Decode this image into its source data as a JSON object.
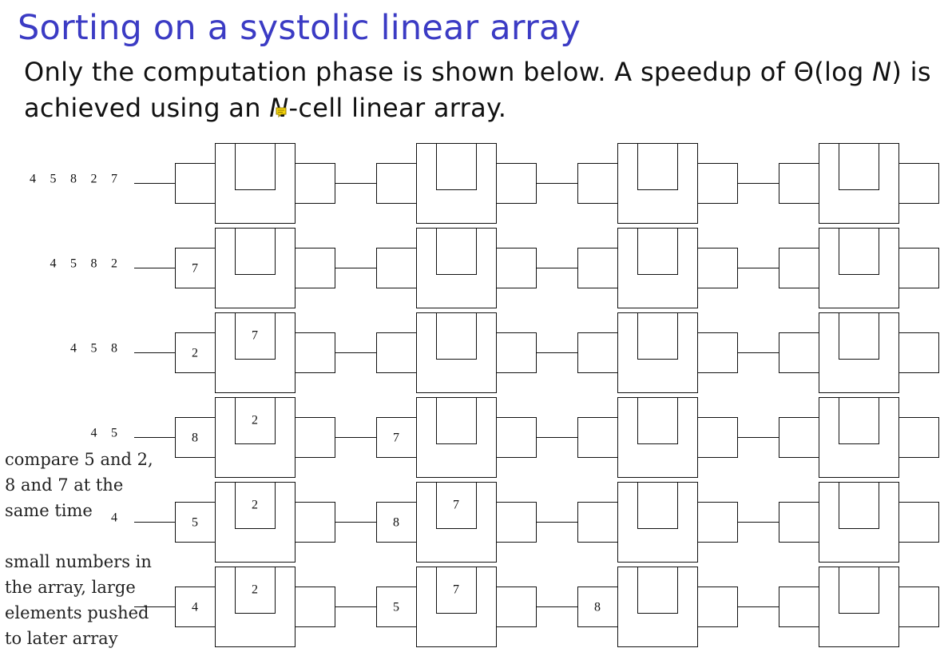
{
  "slide": {
    "title": "Sorting on a systolic linear array",
    "body": {
      "part1": "Only the computation phase is shown below. A speedup of Θ(log ",
      "var1": "N",
      "part2": ") is achieved using an ",
      "var2": "N",
      "part3": "-cell linear array."
    }
  },
  "diagram": {
    "rows": [
      {
        "input": [
          "4",
          "5",
          "8",
          "2",
          "7"
        ],
        "cells": [
          {
            "left": "",
            "top": ""
          },
          {
            "left": "",
            "top": ""
          },
          {
            "left": "",
            "top": ""
          },
          {
            "left": "",
            "top": ""
          }
        ]
      },
      {
        "input": [
          "4",
          "5",
          "8",
          "2"
        ],
        "cells": [
          {
            "left": "7",
            "top": ""
          },
          {
            "left": "",
            "top": ""
          },
          {
            "left": "",
            "top": ""
          },
          {
            "left": "",
            "top": ""
          }
        ]
      },
      {
        "input": [
          "4",
          "5",
          "8"
        ],
        "cells": [
          {
            "left": "2",
            "top": "7"
          },
          {
            "left": "",
            "top": ""
          },
          {
            "left": "",
            "top": ""
          },
          {
            "left": "",
            "top": ""
          }
        ]
      },
      {
        "input": [
          "4",
          "5"
        ],
        "cells": [
          {
            "left": "8",
            "top": "2"
          },
          {
            "left": "7",
            "top": ""
          },
          {
            "left": "",
            "top": ""
          },
          {
            "left": "",
            "top": ""
          }
        ]
      },
      {
        "input": [
          "4"
        ],
        "cells": [
          {
            "left": "5",
            "top": "2"
          },
          {
            "left": "8",
            "top": "7"
          },
          {
            "left": "",
            "top": ""
          },
          {
            "left": "",
            "top": ""
          }
        ]
      },
      {
        "input": [],
        "cells": [
          {
            "left": "4",
            "top": "2"
          },
          {
            "left": "5",
            "top": "7"
          },
          {
            "left": "8",
            "top": ""
          },
          {
            "left": "",
            "top": ""
          }
        ]
      }
    ]
  },
  "annotations": {
    "compare": [
      "compare 5 and 2,",
      "8 and 7 at the",
      "same time"
    ],
    "small": [
      "small numbers in",
      "the array, large",
      "elements pushed",
      "to later array"
    ]
  },
  "colors": {
    "title": "#3b3bc4",
    "line": "#111111",
    "note_icon": "#f2d20b"
  }
}
